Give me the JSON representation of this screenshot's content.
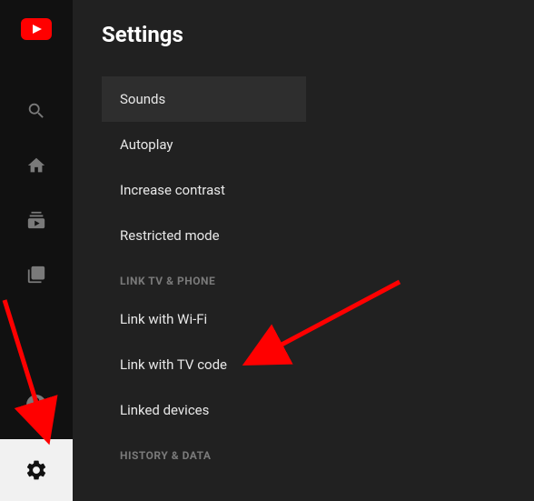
{
  "page": {
    "title": "Settings"
  },
  "sidebar": {
    "icons": {
      "logo": "youtube-logo",
      "search": "search-icon",
      "home": "home-icon",
      "subscriptions": "subscriptions-icon",
      "library": "library-icon",
      "account": "account-icon",
      "settings": "settings-icon"
    }
  },
  "menu": {
    "items": [
      {
        "label": "Sounds",
        "selected": true
      },
      {
        "label": "Autoplay",
        "selected": false
      },
      {
        "label": "Increase contrast",
        "selected": false
      },
      {
        "label": "Restricted mode",
        "selected": false
      }
    ],
    "section1": {
      "header": "LINK TV & PHONE",
      "items": [
        {
          "label": "Link with Wi-Fi"
        },
        {
          "label": "Link with TV code"
        },
        {
          "label": "Linked devices"
        }
      ]
    },
    "section2": {
      "header": "HISTORY & DATA"
    }
  },
  "annotations": {
    "arrow_color": "#ff0000"
  }
}
